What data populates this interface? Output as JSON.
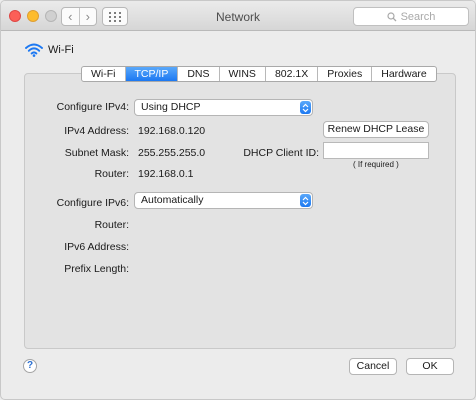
{
  "window": {
    "title": "Network",
    "search_placeholder": "Search",
    "back_glyph": "‹",
    "forward_glyph": "›"
  },
  "interface": {
    "name": "Wi-Fi",
    "icon": "wifi-icon"
  },
  "tabs": [
    {
      "label": "Wi-Fi",
      "active": false
    },
    {
      "label": "TCP/IP",
      "active": true
    },
    {
      "label": "DNS",
      "active": false
    },
    {
      "label": "WINS",
      "active": false
    },
    {
      "label": "802.1X",
      "active": false
    },
    {
      "label": "Proxies",
      "active": false
    },
    {
      "label": "Hardware",
      "active": false
    }
  ],
  "ipv4": {
    "configure_label": "Configure IPv4:",
    "configure_value": "Using DHCP",
    "address_label": "IPv4 Address:",
    "address_value": "192.168.0.120",
    "subnet_label": "Subnet Mask:",
    "subnet_value": "255.255.255.0",
    "router_label": "Router:",
    "router_value": "192.168.0.1",
    "renew_button": "Renew DHCP Lease",
    "client_id_label": "DHCP Client ID:",
    "client_id_value": "",
    "client_id_hint": "( If required )"
  },
  "ipv6": {
    "configure_label": "Configure IPv6:",
    "configure_value": "Automatically",
    "router_label": "Router:",
    "address_label": "IPv6 Address:",
    "prefix_label": "Prefix Length:"
  },
  "footer": {
    "help": "?",
    "cancel": "Cancel",
    "ok": "OK"
  },
  "colors": {
    "accent": "#1c78f2",
    "close": "#fc5f57",
    "minimize": "#fdbc2e"
  }
}
